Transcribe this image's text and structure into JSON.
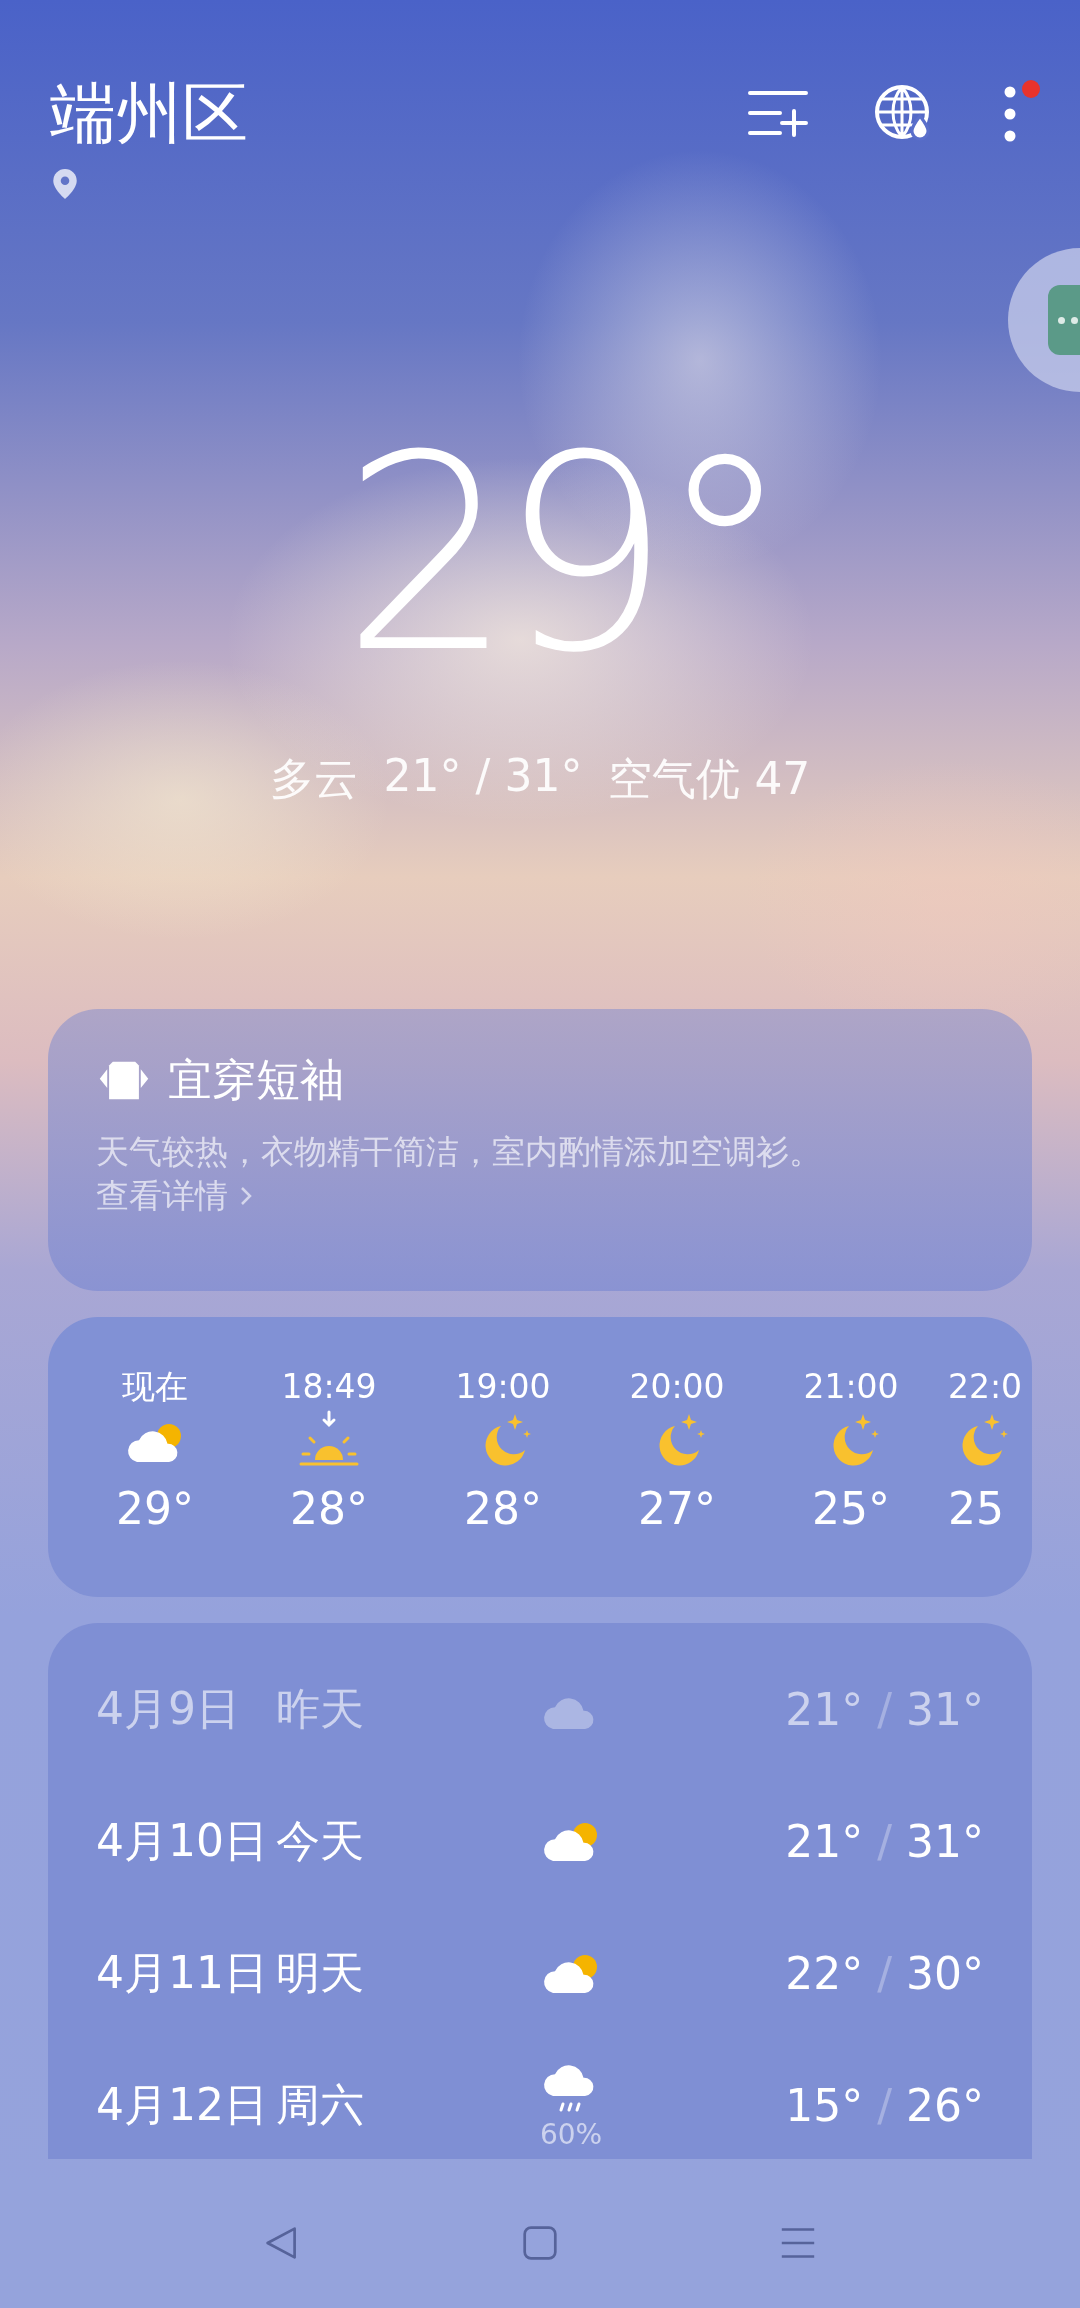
{
  "location": {
    "name": "端州区",
    "is_current": true
  },
  "toolbar": {
    "notification": true
  },
  "current": {
    "temperature": "29°",
    "condition": "多云",
    "range": "21° / 31°",
    "air": "空气优 47"
  },
  "advice": {
    "title": "宜穿短袖",
    "text": "天气较热，衣物精干简洁，室内酌情添加空调衫。",
    "link": "查看详情"
  },
  "hourly": [
    {
      "time": "现在",
      "kind": "partly-cloudy",
      "temp": "29°"
    },
    {
      "time": "18:49",
      "kind": "sunset",
      "temp": "28°"
    },
    {
      "time": "19:00",
      "kind": "moon",
      "temp": "28°"
    },
    {
      "time": "20:00",
      "kind": "moon",
      "temp": "27°"
    },
    {
      "time": "21:00",
      "kind": "moon",
      "temp": "25°"
    },
    {
      "time": "22:0",
      "kind": "moon",
      "temp": "25"
    }
  ],
  "daily": [
    {
      "date": "4月9日",
      "day": "昨天",
      "kind": "cloudy",
      "low": "21°",
      "sep": "/",
      "high": "31°",
      "past": true
    },
    {
      "date": "4月10日",
      "day": "今天",
      "kind": "partly-cloudy",
      "low": "21°",
      "sep": "/",
      "high": "31°",
      "past": false
    },
    {
      "date": "4月11日",
      "day": "明天",
      "kind": "partly-cloudy",
      "low": "22°",
      "sep": "/",
      "high": "30°",
      "past": false
    },
    {
      "date": "4月12日",
      "day": "周六",
      "kind": "rain",
      "precip": "60%",
      "low": "15°",
      "sep": "/",
      "high": "26°",
      "past": false
    }
  ]
}
